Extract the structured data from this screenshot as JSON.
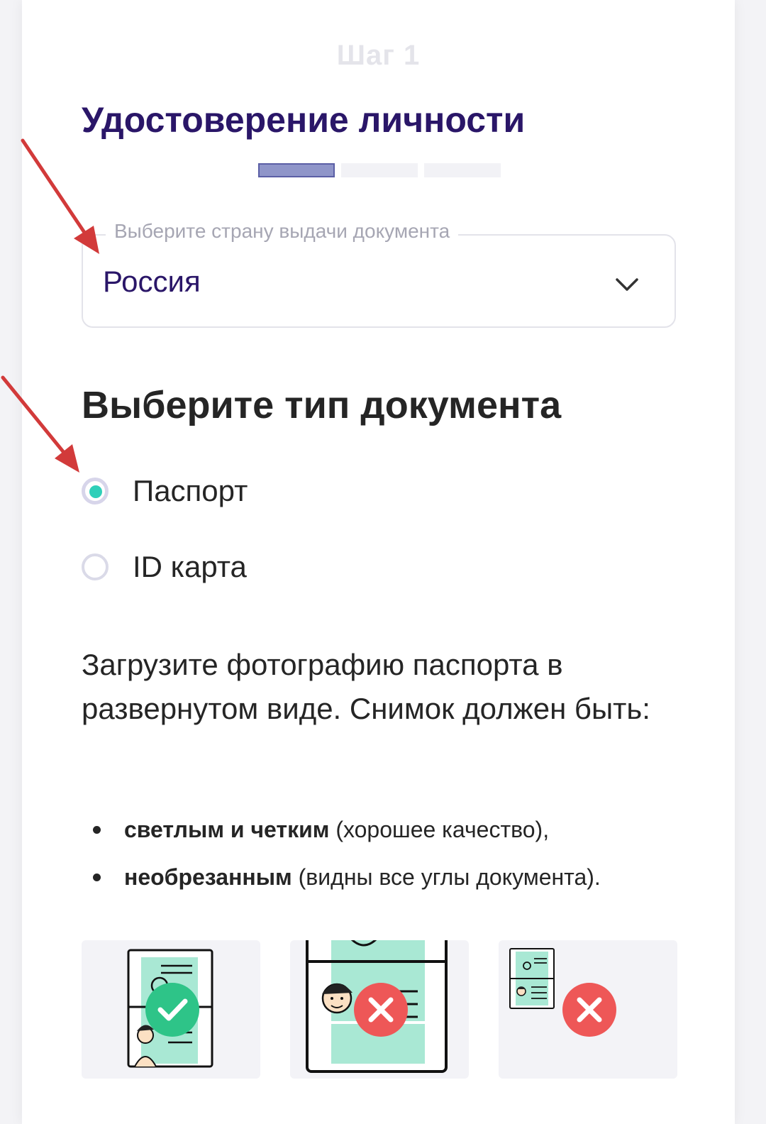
{
  "header": {
    "step": "Шаг 1",
    "title": "Удостоверение личности",
    "progress": {
      "current": 1,
      "total": 3
    }
  },
  "country_select": {
    "legend": "Выберите страну выдачи документа",
    "value": "Россия"
  },
  "doc_type": {
    "heading": "Выберите тип документа",
    "options": [
      {
        "label": "Паспорт",
        "selected": true
      },
      {
        "label": "ID карта",
        "selected": false
      }
    ]
  },
  "instructions": {
    "text": "Загрузите фотографию паспорта в развернутом виде. Снимок должен быть:",
    "bullets": [
      {
        "bold": "светлым и четким",
        "rest": " (хорошее качество),"
      },
      {
        "bold": "необрезанным",
        "rest": " (видны все углы документа)."
      }
    ]
  },
  "examples": [
    {
      "icon": "passport-correct-example",
      "status": "correct"
    },
    {
      "icon": "passport-cropped-example",
      "status": "incorrect"
    },
    {
      "icon": "passport-too-small-example",
      "status": "incorrect"
    }
  ],
  "colors": {
    "title": "#2a1668",
    "accent_teal": "#2fcfb9",
    "progress_active": "#8f95c9",
    "success_green": "#2ec488",
    "error_red": "#ee5757",
    "annotation_arrow": "#d23a3a"
  }
}
